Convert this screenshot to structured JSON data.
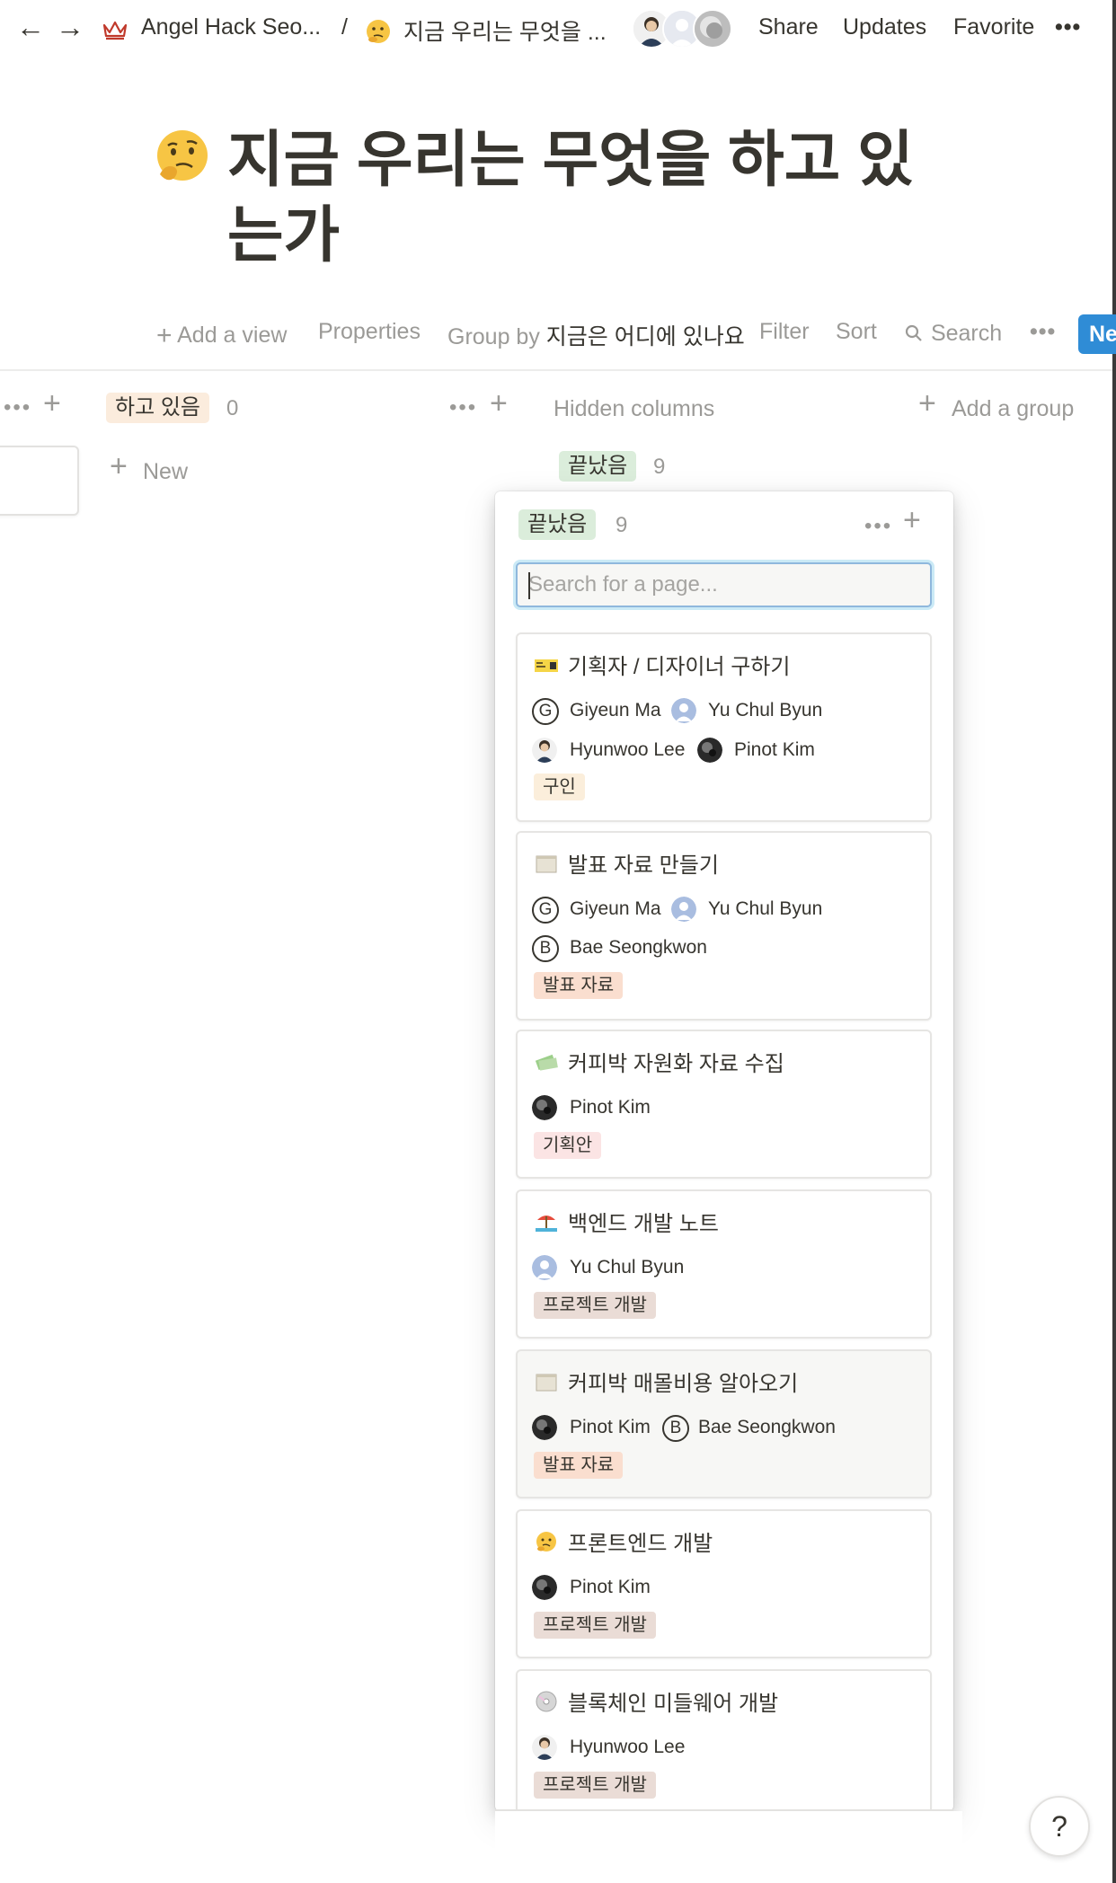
{
  "topbar": {
    "workspace": "Angel Hack Seo...",
    "separator": "/",
    "page": "지금 우리는 무엇을 ...",
    "share": "Share",
    "updates": "Updates",
    "favorite": "Favorite",
    "more": "•••"
  },
  "title": "지금 우리는 무엇을 하고 있는가",
  "toolbar": {
    "add_view": "Add a view",
    "properties": "Properties",
    "group_by_label": "Group by",
    "group_by_value": "지금은 어디에 있나요",
    "filter": "Filter",
    "sort": "Sort",
    "search": "Search",
    "more": "•••",
    "new_label": "Ne"
  },
  "board": {
    "column_doing": {
      "label": "하고 있음",
      "count": "0",
      "new": "New"
    },
    "hidden_columns": "Hidden columns",
    "add_group": "Add a group",
    "hidden_done": {
      "label": "끝났음",
      "count": "9"
    }
  },
  "panel": {
    "label": "끝났음",
    "count": "9",
    "search_placeholder": "Search for a page...",
    "cards": [
      {
        "title": "기획자 / 디자이너 구하기",
        "icon": "notebook-icon",
        "people": [
          "Giyeun Ma",
          "Yu Chul Byun",
          "Hyunwoo Lee",
          "Pinot Kim"
        ],
        "tag": "구인"
      },
      {
        "title": "발표 자료 만들기",
        "icon": "scroll-icon",
        "people": [
          "Giyeun Ma",
          "Yu Chul Byun",
          "Bae Seongkwon"
        ],
        "tag": "발표 자료"
      },
      {
        "title": "커피박 자원화 자료 수집",
        "icon": "money-icon",
        "people": [
          "Pinot Kim"
        ],
        "tag": "기획안"
      },
      {
        "title": "백엔드 개발 노트",
        "icon": "beach-icon",
        "people": [
          "Yu Chul Byun"
        ],
        "tag": "프로젝트 개발"
      },
      {
        "title": "커피박 매몰비용 알아오기",
        "icon": "scroll-icon",
        "people": [
          "Pinot Kim",
          "Bae Seongkwon"
        ],
        "tag": "발표 자료"
      },
      {
        "title": "프론트엔드 개발",
        "icon": "thinking-face-icon",
        "people": [
          "Pinot Kim"
        ],
        "tag": "프로젝트 개발"
      },
      {
        "title": "블록체인 미들웨어 개발",
        "icon": "disc-icon",
        "people": [
          "Hyunwoo Lee"
        ],
        "tag": "프로젝트 개발"
      }
    ]
  },
  "avatar_letters": {
    "giyeun": "G",
    "bae": "B"
  },
  "help": "?",
  "colors": {
    "doing_tag_bg": "#fbecdd",
    "done_tag_bg": "#dbeddb",
    "tag_hiring": "#fbeedb",
    "tag_presentation": "#fadecf",
    "tag_plan": "#fbe4e4",
    "tag_dev": "#eadcd6"
  }
}
